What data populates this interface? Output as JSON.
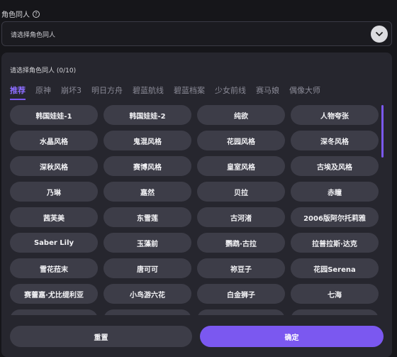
{
  "field": {
    "label": "角色同人",
    "help_glyph": "?",
    "placeholder": "请选择角色同人"
  },
  "panel": {
    "title": "请选择角色同人 (0/10)",
    "tabs": [
      {
        "label": "推荐",
        "active": true
      },
      {
        "label": "原神",
        "active": false
      },
      {
        "label": "崩坏3",
        "active": false
      },
      {
        "label": "明日方舟",
        "active": false
      },
      {
        "label": "碧蓝航线",
        "active": false
      },
      {
        "label": "碧蓝档案",
        "active": false
      },
      {
        "label": "少女前线",
        "active": false
      },
      {
        "label": "赛马娘",
        "active": false
      },
      {
        "label": "偶像大师",
        "active": false
      }
    ],
    "items": [
      "韩国娃娃-1",
      "韩国娃娃-2",
      "纯欲",
      "人物夸张",
      "水晶风格",
      "鬼混风格",
      "花园风格",
      "深冬风格",
      "深秋风格",
      "赛博风格",
      "皇室风格",
      "古埃及风格",
      "乃琳",
      "嘉然",
      "贝拉",
      "赤瞳",
      "茜芙美",
      "东雪莲",
      "古河渚",
      "2006版阿尔托莉雅",
      "Saber Lily",
      "玉藻前",
      "鹦鹉·古拉",
      "拉普拉斯·达克",
      "雪花菈末",
      "唐可可",
      "祢豆子",
      "花园Serena",
      "赛蕾嘉·尤比缇利亚",
      "小鸟游六花",
      "白金狮子",
      "七海",
      "",
      "",
      "",
      ""
    ]
  },
  "footer": {
    "reset_label": "重置",
    "confirm_label": "确定"
  },
  "colors": {
    "accent": "#7b58f0",
    "chip_bg": "#3d3d48",
    "panel_bg": "#26262e",
    "page_bg": "#16161a"
  }
}
